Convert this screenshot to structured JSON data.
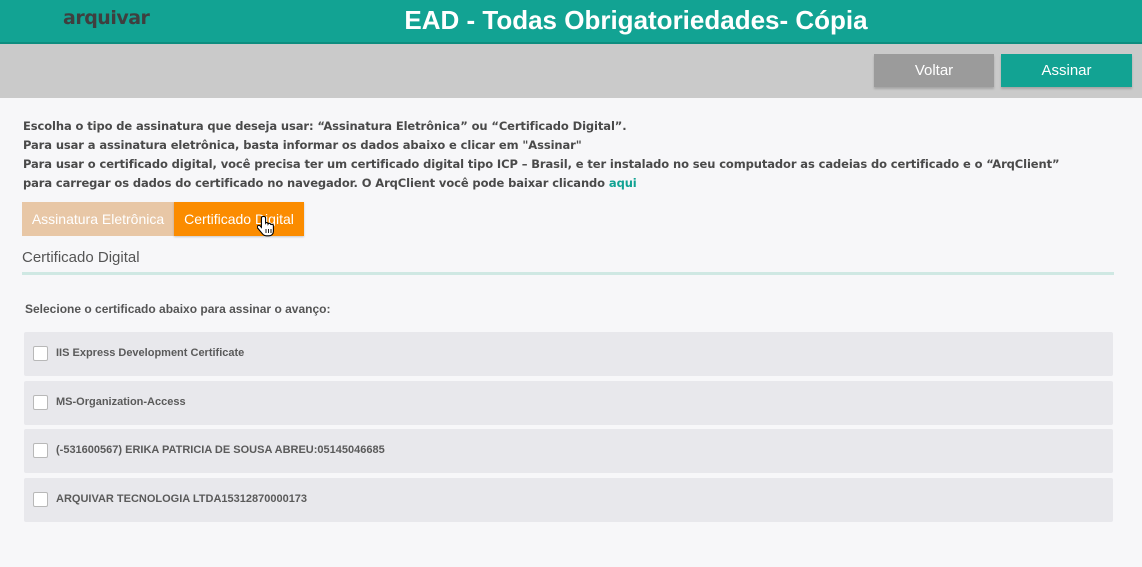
{
  "header": {
    "logo": "arquivar",
    "title": "EAD - Todas Obrigatoriedades- Cópia"
  },
  "toolbar": {
    "back_label": "Voltar",
    "sign_label": "Assinar"
  },
  "instructions": {
    "line1": "Escolha o tipo de assinatura que deseja usar: “Assinatura Eletrônica” ou “Certificado Digital”.",
    "line2": "Para usar a assinatura eletrônica, basta informar os dados abaixo e clicar em \"Assinar\"",
    "line3": "Para usar o certificado digital, você precisa ter um certificado digital tipo ICP – Brasil, e ter instalado no seu computador as cadeias do certificado e o “ArqClient”",
    "line4": "para carregar os dados do certificado no navegador. O ArqClient você pode baixar clicando",
    "link": "aqui"
  },
  "tabs": {
    "electronic": "Assinatura Eletrônica",
    "certificate": "Certificado Digital",
    "active": "certificate"
  },
  "section": {
    "title": "Certificado Digital",
    "select_label": "Selecione o certificado abaixo para assinar o avanço:"
  },
  "certificates": [
    {
      "label": "IIS Express Development Certificate",
      "checked": false
    },
    {
      "label": "MS-Organization-Access",
      "checked": false
    },
    {
      "label": "(-531600567) ERIKA PATRICIA DE SOUSA ABREU:05145046685",
      "checked": false
    },
    {
      "label": "ARQUIVAR TECNOLOGIA LTDA15312870000173",
      "checked": false
    }
  ],
  "colors": {
    "brand_teal": "#12a393",
    "active_tab": "#fb8c00",
    "inactive_tab": "#e8c7a6",
    "back_button": "#9b9b9b"
  },
  "icons": {
    "cursor": "hand-pointer-icon"
  }
}
